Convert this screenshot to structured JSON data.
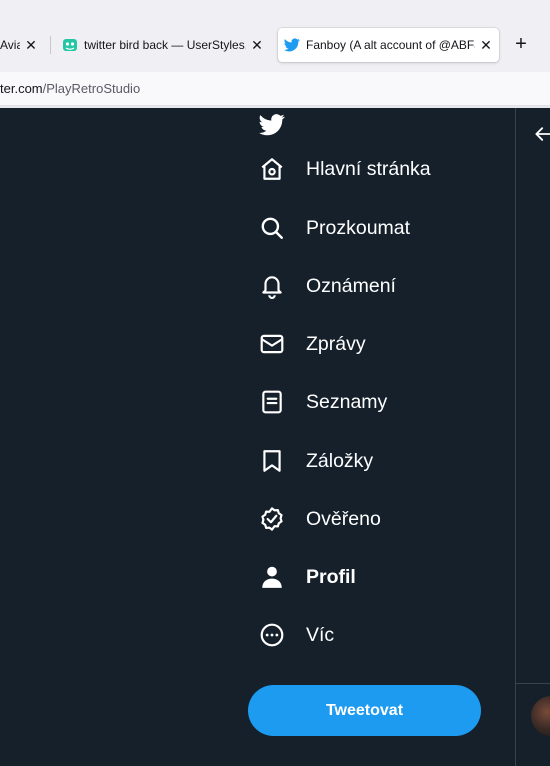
{
  "browser": {
    "tabs": [
      {
        "title": "Avian",
        "close": "✕"
      },
      {
        "title": "twitter bird back — UserStyles.world",
        "close": "✕"
      },
      {
        "title": "Fanboy (A alt account of @ABFanboy",
        "close": "✕"
      }
    ],
    "new_tab": "+",
    "url_host": "ter.com",
    "url_path": "/PlayRetroStudio"
  },
  "nav": {
    "items": [
      {
        "label": "Hlavní stránka",
        "icon": "home-icon"
      },
      {
        "label": "Prozkoumat",
        "icon": "search-icon"
      },
      {
        "label": "Oznámení",
        "icon": "bell-icon"
      },
      {
        "label": "Zprávy",
        "icon": "mail-icon"
      },
      {
        "label": "Seznamy",
        "icon": "list-icon"
      },
      {
        "label": "Záložky",
        "icon": "bookmark-icon"
      },
      {
        "label": "Ověřeno",
        "icon": "verified-icon"
      },
      {
        "label": "Profil",
        "icon": "person-icon"
      },
      {
        "label": "Víc",
        "icon": "more-icon"
      }
    ]
  },
  "tweet_button": "Tweetovat",
  "colors": {
    "background": "#15202b",
    "accent": "#1d9bf0"
  }
}
